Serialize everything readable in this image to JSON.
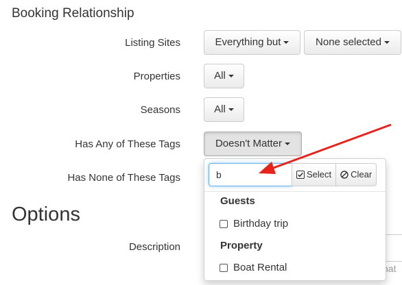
{
  "section_title": "Booking Relationship",
  "options_title": "Options",
  "fields": {
    "listing_sites": {
      "label": "Listing Sites",
      "button1": "Everything but",
      "button2": "None selected"
    },
    "properties": {
      "label": "Properties",
      "button": "All"
    },
    "seasons": {
      "label": "Seasons",
      "button": "All"
    },
    "has_any_tags": {
      "label": "Has Any of These Tags",
      "button": "Doesn't Matter"
    },
    "has_none_tags": {
      "label": "Has None of These Tags"
    },
    "description": {
      "label": "Description",
      "hint": "nat"
    }
  },
  "dropdown": {
    "filter_value": "b",
    "select_label": "Select",
    "clear_label": "Clear",
    "groups": [
      {
        "header": "Guests",
        "options": [
          {
            "label": "Birthday trip",
            "checked": false
          }
        ]
      },
      {
        "header": "Property",
        "options": [
          {
            "label": "Boat Rental",
            "checked": false
          }
        ]
      }
    ]
  },
  "annotation": {
    "arrow_color": "#e8221b"
  }
}
